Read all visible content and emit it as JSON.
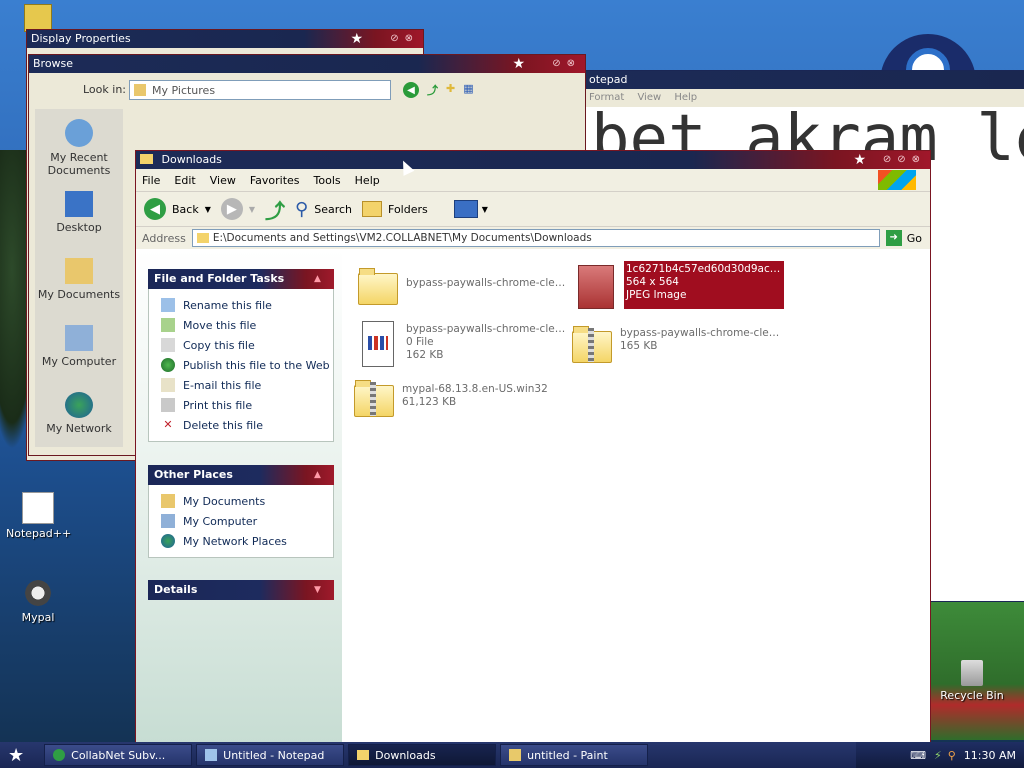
{
  "desktop": {
    "icons": [
      {
        "label": "Notepad++"
      },
      {
        "label": "Mypal"
      },
      {
        "label": "Recycle Bin"
      }
    ]
  },
  "display_properties": {
    "title": "Display Properties"
  },
  "browse": {
    "title": "Browse",
    "look_in_label": "Look in:",
    "look_in_value": "My Pictures",
    "places": [
      "My Recent Documents",
      "Desktop",
      "My Documents",
      "My Computer",
      "My Network"
    ]
  },
  "notepad": {
    "title": "otepad",
    "menu": [
      "Format",
      "View",
      "Help"
    ],
    "text": "bet akram le"
  },
  "explorer": {
    "title": "Downloads",
    "menu": [
      "File",
      "Edit",
      "View",
      "Favorites",
      "Tools",
      "Help"
    ],
    "toolbar": {
      "back": "Back",
      "search": "Search",
      "folders": "Folders"
    },
    "address_label": "Address",
    "address_value": "E:\\Documents and Settings\\VM2.COLLABNET\\My Documents\\Downloads",
    "go_label": "Go",
    "tasks_panel": {
      "title": "File and Folder Tasks",
      "items": [
        "Rename this file",
        "Move this file",
        "Copy this file",
        "Publish this file to the Web",
        "E-mail this file",
        "Print this file",
        "Delete this file"
      ]
    },
    "other_places": {
      "title": "Other Places",
      "items": [
        "My Documents",
        "My Computer",
        "My Network Places"
      ]
    },
    "details": {
      "title": "Details"
    },
    "files": [
      {
        "name": "bypass-paywalls-chrome-clea...",
        "line2": "",
        "line3": "",
        "type": "folder"
      },
      {
        "name": "1c6271b4c57ed60d30d9ac93...",
        "line2": "564 x 564",
        "line3": "JPEG Image",
        "type": "image",
        "selected": true
      },
      {
        "name": "bypass-paywalls-chrome-clea...",
        "line2": "0 File",
        "line3": "162 KB",
        "type": "file"
      },
      {
        "name": "bypass-paywalls-chrome-clea...",
        "line2": "165 KB",
        "line3": "",
        "type": "zip"
      },
      {
        "name": "mypal-68.13.8.en-US.win32",
        "line2": "61,123 KB",
        "line3": "",
        "type": "zip"
      }
    ]
  },
  "taskbar": {
    "buttons": [
      {
        "label": "CollabNet Subv...",
        "active": false
      },
      {
        "label": "Untitled - Notepad",
        "active": false
      },
      {
        "label": "Downloads",
        "active": true
      },
      {
        "label": "untitled - Paint",
        "active": false
      }
    ],
    "clock": "11:30 AM"
  }
}
